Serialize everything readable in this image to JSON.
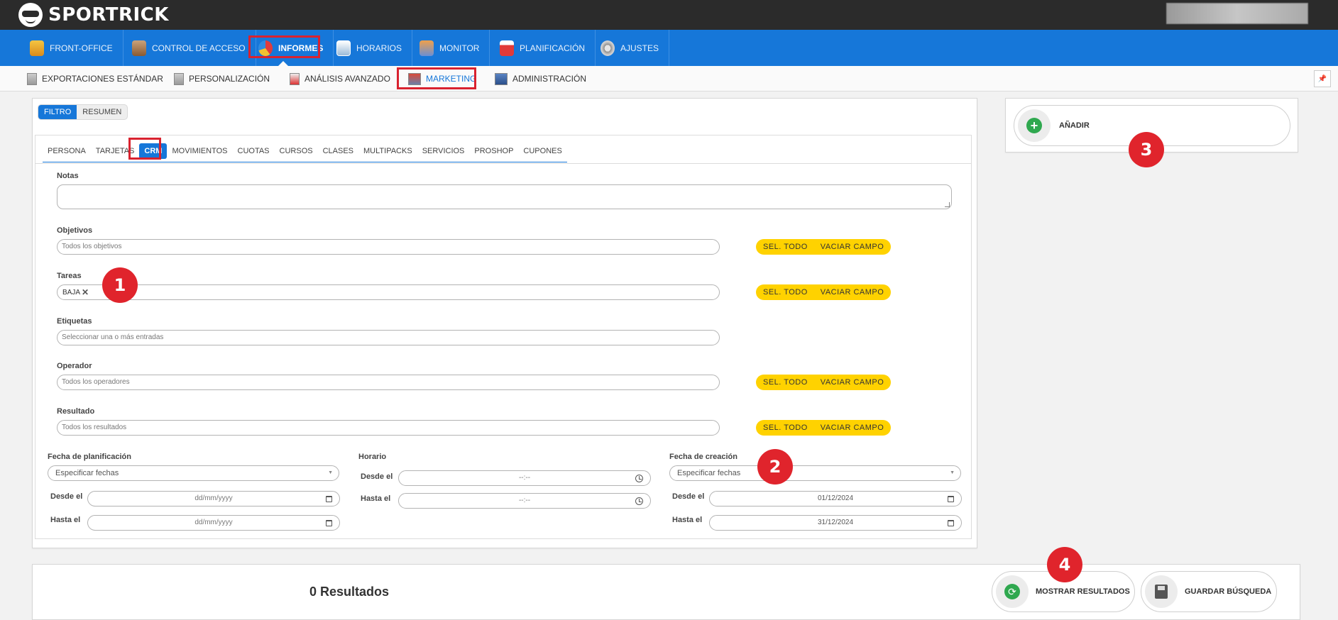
{
  "app": {
    "logo": "SPORTRICK"
  },
  "main_nav": [
    {
      "label": "FRONT-OFFICE",
      "icon": "person-icon"
    },
    {
      "label": "CONTROL DE ACCESO",
      "icon": "access-icon"
    },
    {
      "label": "INFORMES",
      "icon": "pie-chart-icon",
      "active": true
    },
    {
      "label": "HORARIOS",
      "icon": "schedule-icon"
    },
    {
      "label": "MONITOR",
      "icon": "monitor-icon"
    },
    {
      "label": "PLANIFICACIÓN",
      "icon": "calendar-icon"
    },
    {
      "label": "AJUSTES",
      "icon": "gear-icon"
    }
  ],
  "sub_nav": [
    {
      "label": "EXPORTACIONES ESTÁNDAR"
    },
    {
      "label": "PERSONALIZACIÓN"
    },
    {
      "label": "ANÁLISIS AVANZADO"
    },
    {
      "label": "MARKETING",
      "active": true
    },
    {
      "label": "ADMINISTRACIÓN"
    }
  ],
  "pin_icon": "📌",
  "toggle": {
    "filter": "FILTRO",
    "summary": "RESUMEN"
  },
  "tabs": [
    "PERSONA",
    "TARJETAS",
    "CRM",
    "MOVIMIENTOS",
    "CUOTAS",
    "CURSOS",
    "CLASES",
    "MULTIPACKS",
    "SERVICIOS",
    "PROSHOP",
    "CUPONES"
  ],
  "form": {
    "notas_label": "Notas",
    "objetivos_label": "Objetivos",
    "objetivos_placeholder": "Todos los objetivos",
    "tareas_label": "Tareas",
    "tareas_chip": "BAJA",
    "etiquetas_label": "Etiquetas",
    "etiquetas_placeholder": "Seleccionar una o más entradas",
    "operador_label": "Operador",
    "operador_placeholder": "Todos los operadores",
    "resultado_label": "Resultado",
    "resultado_placeholder": "Todos los resultados",
    "sel_todo": "SEL. TODO",
    "vaciar": "VACIAR CAMPO"
  },
  "dates": {
    "planificacion_label": "Fecha de planificación",
    "planificacion_select": "Especificar fechas",
    "horario_label": "Horario",
    "creacion_label": "Fecha de creación",
    "creacion_select": "Especificar fechas",
    "desde": "Desde el",
    "hasta": "Hasta el",
    "date_placeholder": "dd/mm/yyyy",
    "time_placeholder": "--:--",
    "creacion_desde": "01/12/2024",
    "creacion_hasta": "31/12/2024"
  },
  "right_panel": {
    "add": "AÑADIR"
  },
  "results": {
    "title": "0 Resultados",
    "show": "MOSTRAR RESULTADOS",
    "save": "GUARDAR BÚSQUEDA"
  },
  "badges": [
    "1",
    "2",
    "3",
    "4"
  ],
  "colors": {
    "brand_blue": "#1677d9",
    "accent_yellow": "#ffd200",
    "marker_red": "#e0242c",
    "topbar": "#2b2b2b"
  }
}
